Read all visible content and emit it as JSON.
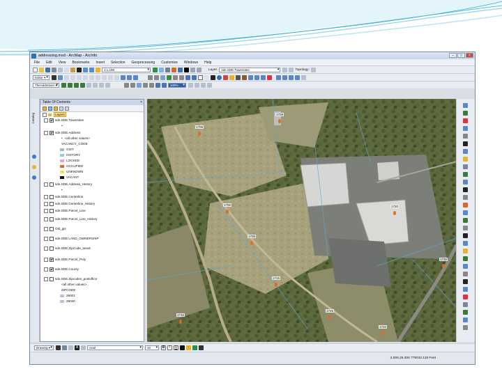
{
  "window": {
    "title": "addressing.mxd - ArcMap - ArcInfo",
    "buttons": {
      "minimize": "–",
      "maximize": "□",
      "close": "×"
    }
  },
  "menu": [
    "File",
    "Edit",
    "View",
    "Bookmarks",
    "Insert",
    "Selection",
    "Geoprocessing",
    "Customize",
    "Windows",
    "Help"
  ],
  "toolbar": {
    "scale": "1:1,198",
    "layer_label": "Layer:",
    "layer_value": "sde.SDE.Towersites",
    "topology_label": "Topology:",
    "editor_label": "Editor ▾",
    "addresser_label": "TheAddresser ▾",
    "zoom_value": "100%"
  },
  "toc": {
    "title": "Table Of Contents",
    "close": "×",
    "layers_label": "Layers",
    "items": [
      {
        "label": "sde.SDE.Towersites",
        "checked": true,
        "kind": "layer"
      },
      {
        "label": "",
        "kind": "dot"
      },
      {
        "label": "sde.SDE.Address",
        "checked": true,
        "kind": "layer"
      },
      {
        "label": "<all other values>",
        "kind": "dot"
      },
      {
        "label": "VACANCY_CODE",
        "kind": "text"
      },
      {
        "label": "GIST",
        "kind": "sym",
        "color": "#b0b4bc"
      },
      {
        "label": "HISTORY",
        "kind": "sym",
        "color": "#9ec4e8"
      },
      {
        "label": "LOCKED",
        "kind": "sym",
        "color": "#e8a9c9"
      },
      {
        "label": "OCCUPIED",
        "kind": "sym",
        "color": "#e06a2b"
      },
      {
        "label": "UNKNOWN",
        "kind": "sym",
        "color": "#f0e24a"
      },
      {
        "label": "VACANT",
        "kind": "sym",
        "color": "#111111"
      },
      {
        "label": "sde.SDE.Address_History",
        "checked": false,
        "kind": "layer"
      },
      {
        "label": "",
        "kind": "dot"
      },
      {
        "label": "sde.SDE.Centerline",
        "checked": false,
        "kind": "layer"
      },
      {
        "label": "sde.SDE.Centerline_History",
        "checked": false,
        "kind": "layer"
      },
      {
        "label": "sde.SDE.Parcel_Line",
        "checked": false,
        "kind": "layer"
      },
      {
        "label": "sde.SDE.Parcel_Line_History",
        "checked": false,
        "kind": "layer"
      },
      {
        "label": "Old_gis",
        "checked": false,
        "kind": "layer"
      },
      {
        "label": "sde.SDE.LAND_OWNERSHIP",
        "checked": false,
        "kind": "layer"
      },
      {
        "label": "sde.SDE.ZipCode_areas",
        "checked": false,
        "kind": "layer"
      },
      {
        "label": "sde.SDE.Parcel_Poly",
        "checked": true,
        "kind": "layer"
      },
      {
        "label": "sde.SDE.County",
        "checked": true,
        "kind": "layer"
      },
      {
        "label": "sde.SDE.Zipcodes_postoffice",
        "checked": false,
        "kind": "layer"
      },
      {
        "label": "<all other values>",
        "kind": "text"
      },
      {
        "label": "ZIPCODE",
        "kind": "text"
      },
      {
        "label": "29001",
        "kind": "sym",
        "color": "#c9b8e0"
      },
      {
        "label": "29040",
        "kind": "sym",
        "color": "#c9b8e0"
      }
    ]
  },
  "sidebar": {
    "tab_label": "Catalog"
  },
  "map": {
    "address_labels": [
      "1709",
      "1708",
      "1700",
      "1705",
      "1715",
      "1716",
      "1725",
      "1720",
      "1730",
      "1740"
    ]
  },
  "drawbar": {
    "drawing_label": "Drawing ▾",
    "font": "Arial",
    "size": "10"
  },
  "status": {
    "coordinates": "2,006,26.305  779042.118 Feet"
  }
}
